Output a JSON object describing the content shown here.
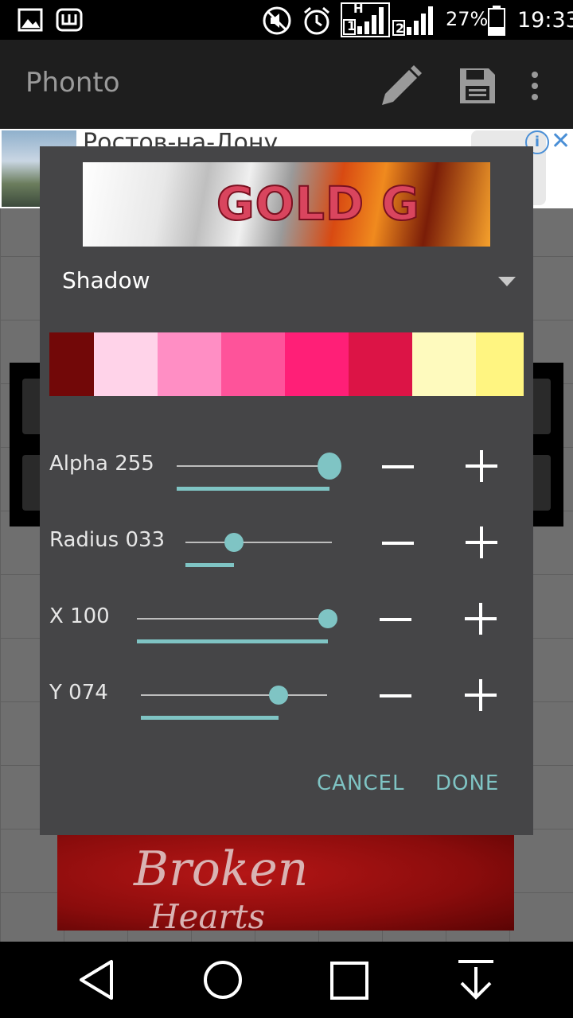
{
  "status_bar": {
    "icons": [
      "image-icon",
      "phonto-notification-icon",
      "mute-icon",
      "alarm-icon",
      "signal-sim1-icon",
      "signal-sim2-icon",
      "battery-icon"
    ],
    "sim1_network": "H",
    "sim1_number": "1",
    "sim2_number": "2",
    "battery": "27%",
    "time": "19:33"
  },
  "app_bar": {
    "title": "Phonto",
    "actions": [
      "pencil-icon",
      "save-icon",
      "more-vert-icon"
    ]
  },
  "ad": {
    "text": "Ростов-на-Дону"
  },
  "background_art": {
    "line1": "Broken",
    "line2": "Hearts"
  },
  "dialog": {
    "preview_text": "GOLD G",
    "mode": "Shadow",
    "palette": [
      "#720808",
      "#ffd3e9",
      "#ff8ec4",
      "#fe539a",
      "#ff1f77",
      "#dc1446",
      "#fefabe",
      "#fff581"
    ],
    "sliders": [
      {
        "label": "Alpha",
        "value_text": "255",
        "fraction": 1.0
      },
      {
        "label": "Radius",
        "value_text": "033",
        "fraction": 0.33
      },
      {
        "label": "X",
        "value_text": "100",
        "fraction": 1.0
      },
      {
        "label": "Y",
        "value_text": "074",
        "fraction": 0.74
      }
    ],
    "cancel_label": "CANCEL",
    "done_label": "DONE",
    "accent_color": "#7fc4c4"
  },
  "nav_bar": {
    "buttons": [
      "back-icon",
      "home-icon",
      "recents-icon",
      "hide-keyboard-icon"
    ]
  }
}
